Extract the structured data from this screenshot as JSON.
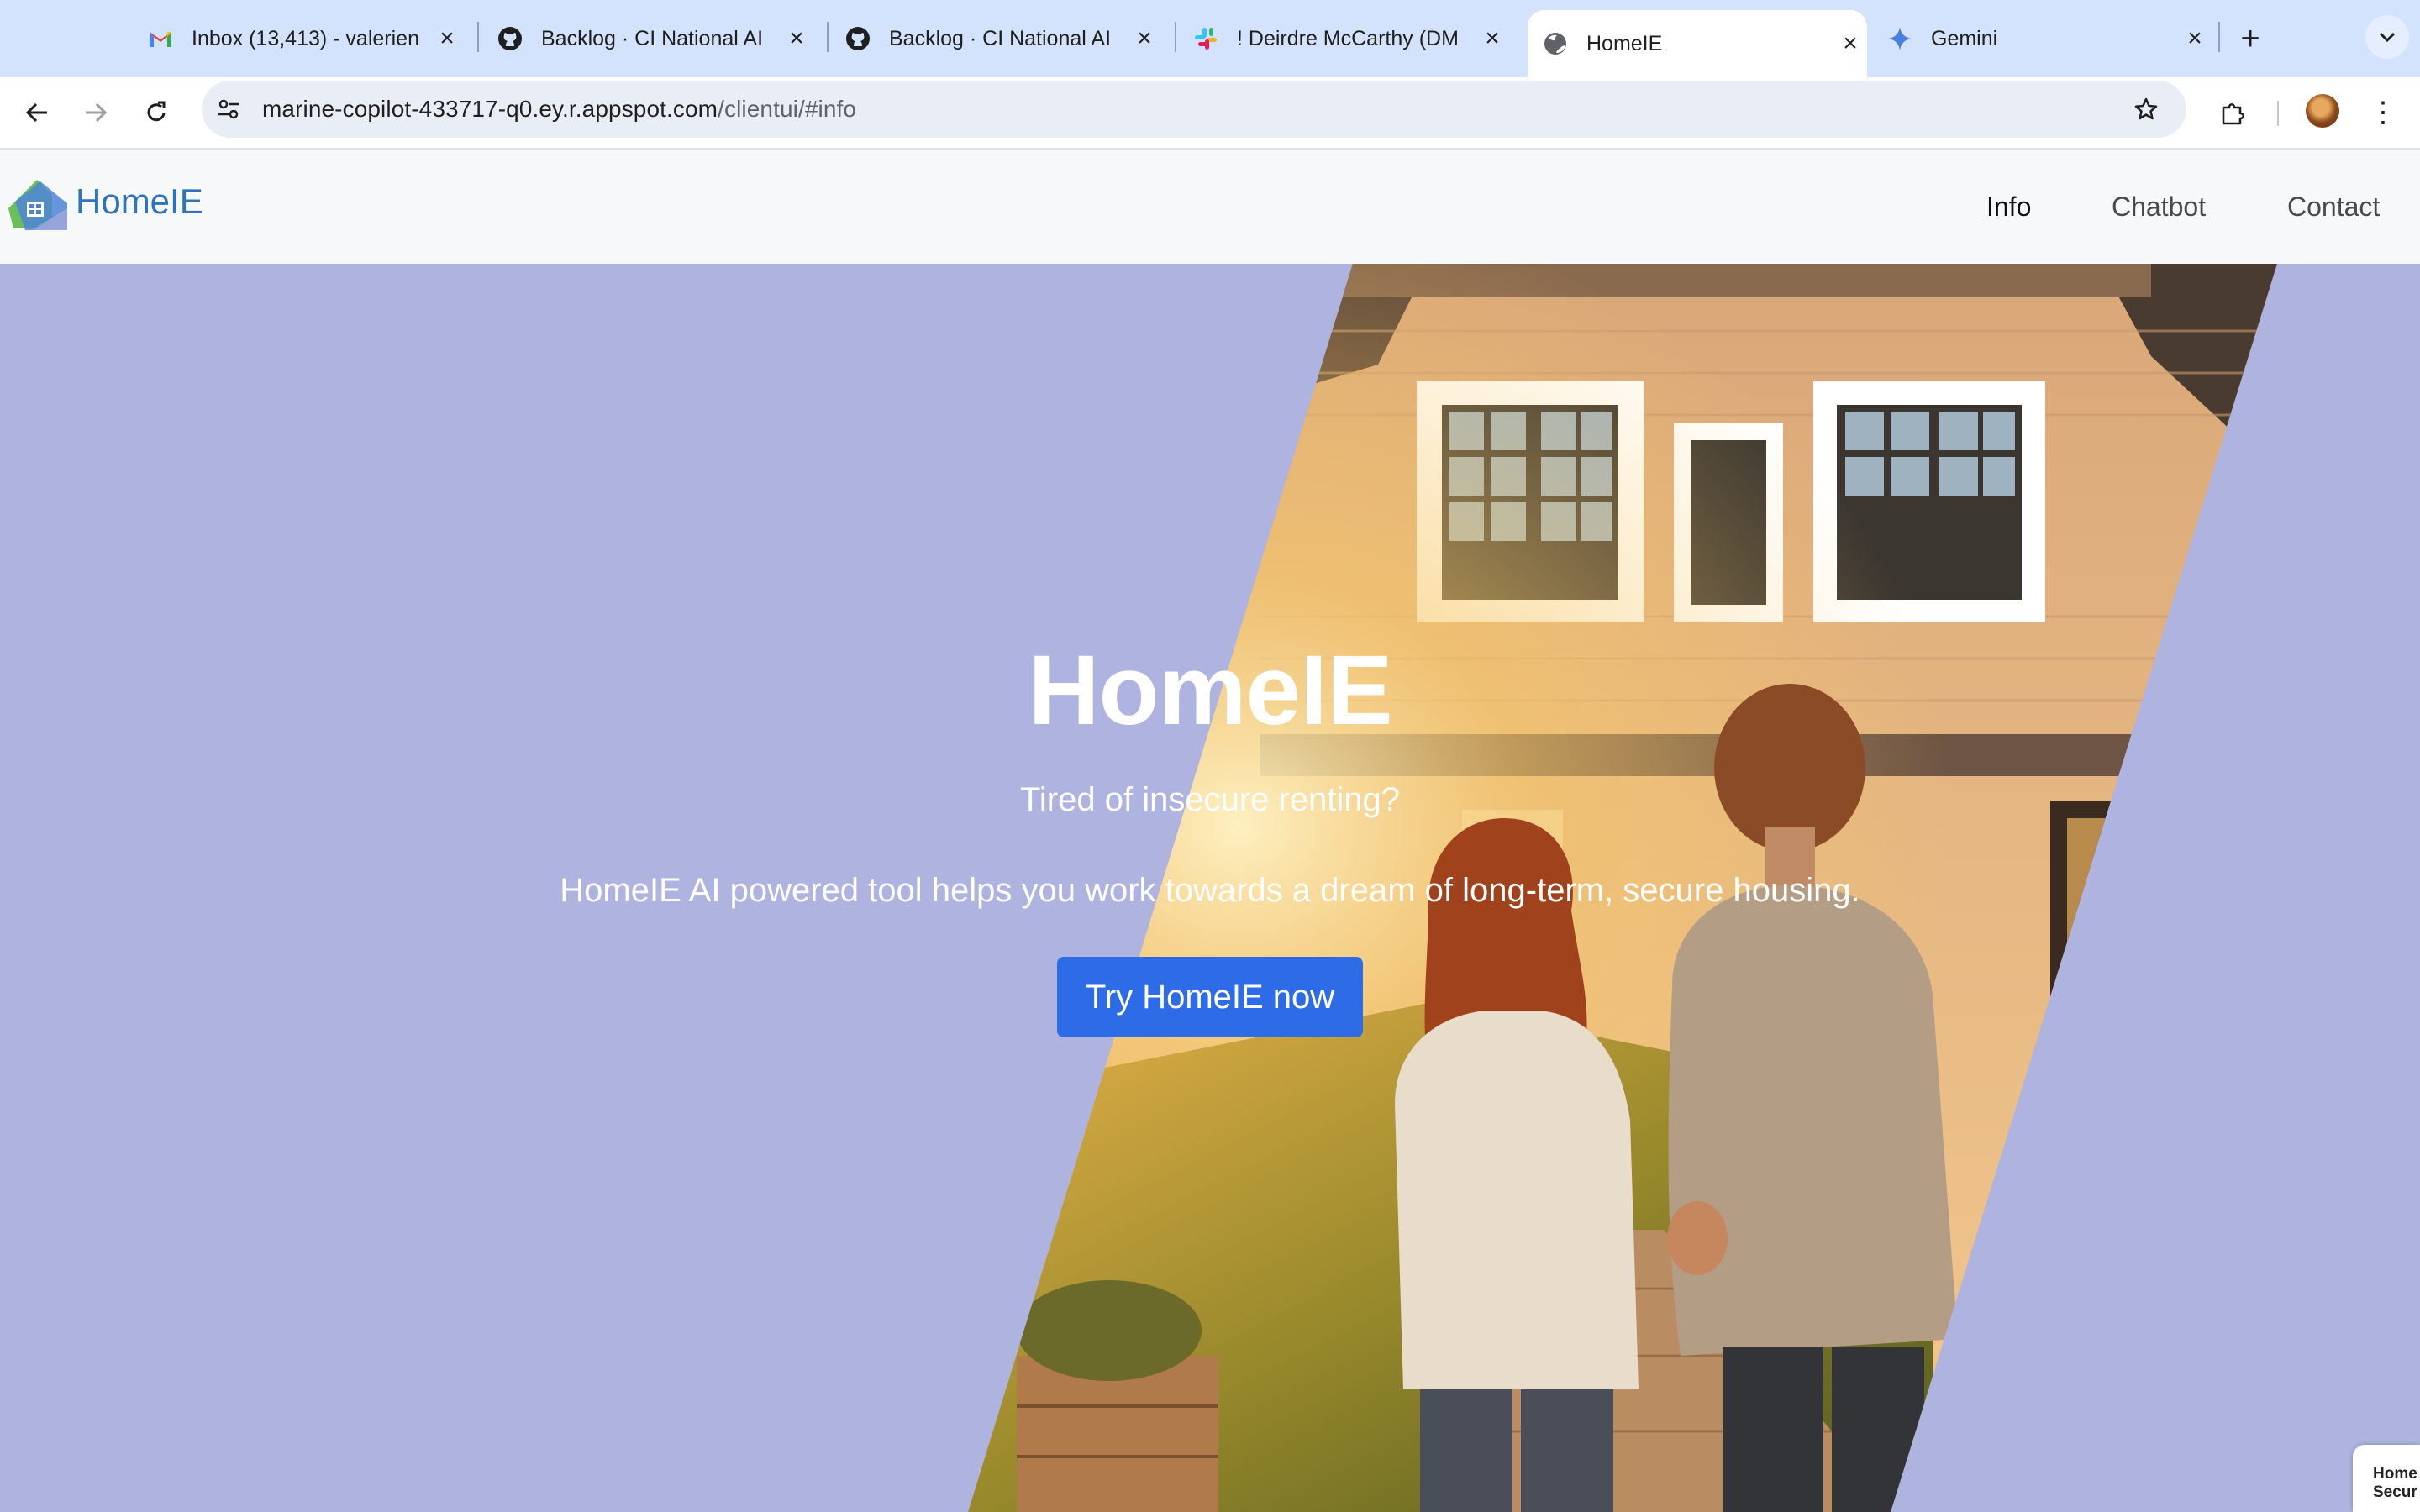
{
  "tabs": [
    {
      "title": "Inbox (13,413) - valerien",
      "icon": "gmail-icon"
    },
    {
      "title": "Backlog · CI National AI",
      "icon": "github-icon"
    },
    {
      "title": "Backlog · CI National AI",
      "icon": "github-icon"
    },
    {
      "title": "! Deirdre McCarthy (DM",
      "icon": "slack-icon"
    },
    {
      "title": "HomeIE",
      "icon": "globe-icon",
      "active": true
    },
    {
      "title": "Gemini",
      "icon": "gemini-icon"
    }
  ],
  "address_bar": {
    "host": "marine-copilot-433717-q0.ey.r.appspot.com",
    "path": "/clientui/#info"
  },
  "site": {
    "brand": "HomeIE",
    "nav": [
      "Info",
      "Chatbot",
      "Contact"
    ],
    "active_nav": "Info"
  },
  "hero": {
    "title": "HomeIE",
    "subtitle": "Tired of insecure renting?",
    "description": "HomeIE AI powered tool helps you work towards a dream of long-term, secure housing.",
    "cta_label": "Try HomeIE now"
  },
  "corner_widget": {
    "text": "Home Secur"
  },
  "colors": {
    "tab_strip": "#d3e3fd",
    "hero_background": "#aeb4df",
    "cta_button": "#2e6be6",
    "brand_text": "#2f73b8"
  }
}
